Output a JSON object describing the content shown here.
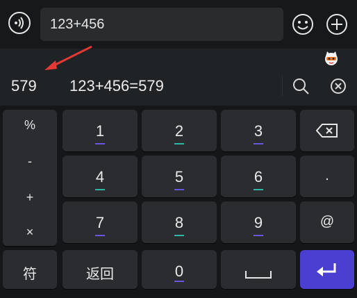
{
  "input": {
    "text": "123+456"
  },
  "candidates": {
    "first": "579",
    "second": "123+456=579"
  },
  "keypad": {
    "symbols": [
      "%",
      "-",
      "+",
      "×"
    ],
    "digits": [
      "1",
      "2",
      "3",
      "4",
      "5",
      "6",
      "7",
      "8",
      "9"
    ],
    "right_column": [
      ".",
      "@"
    ],
    "bottom": {
      "symbol_key": "符",
      "back_key": "返回",
      "zero": "0"
    }
  },
  "icons": {
    "voice": "voice-icon",
    "emoji": "emoji-icon",
    "plus": "plus-icon",
    "mascot": "mascot-icon",
    "search": "search-icon",
    "clear": "close-circle-icon",
    "backspace": "backspace-icon",
    "space": "space-icon",
    "enter": "enter-icon"
  },
  "colors": {
    "accent": "#4a3fd1",
    "teal": "#2fb7a6",
    "purple": "#6757e0",
    "arrow": "#e53935"
  }
}
